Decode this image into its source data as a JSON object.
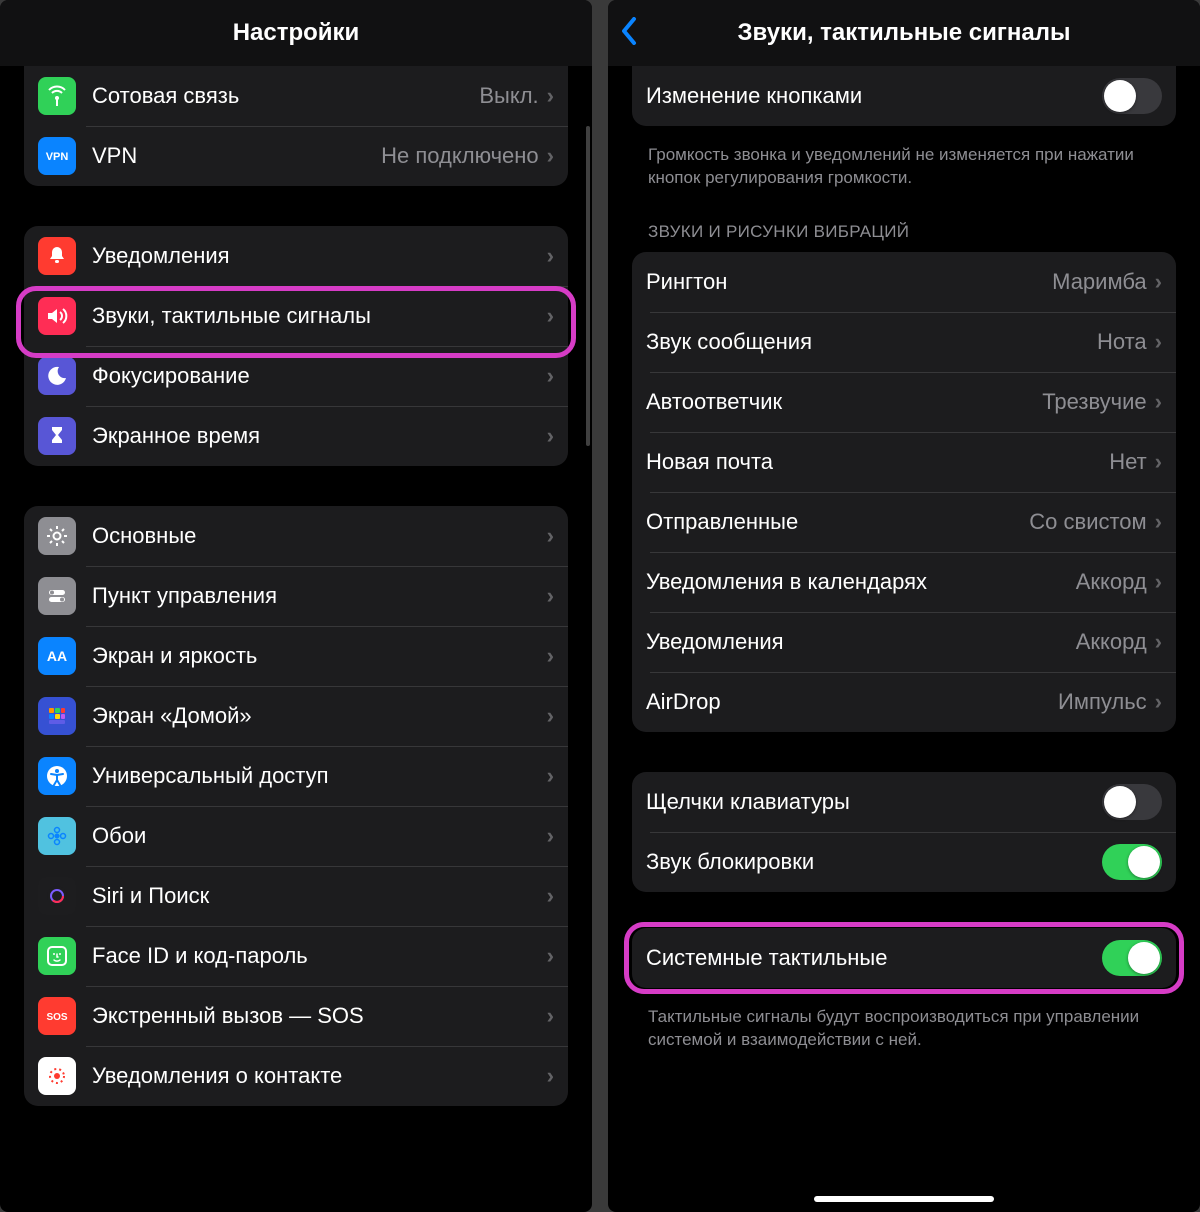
{
  "left": {
    "title": "Настройки",
    "group1": [
      {
        "icon": "antenna",
        "bg": "#30d158",
        "label": "Сотовая связь",
        "value": "Выкл."
      },
      {
        "icon": "vpn",
        "bg": "#0a84ff",
        "label": "VPN",
        "value": "Не подключено"
      }
    ],
    "group2": [
      {
        "icon": "bell",
        "bg": "#ff3b30",
        "label": "Уведомления"
      },
      {
        "icon": "speaker",
        "bg": "#ff2d55",
        "label": "Звуки, тактильные сигналы"
      },
      {
        "icon": "moon",
        "bg": "#5856d6",
        "label": "Фокусирование"
      },
      {
        "icon": "hourglass",
        "bg": "#5856d6",
        "label": "Экранное время"
      }
    ],
    "group3": [
      {
        "icon": "gear",
        "bg": "#8e8e93",
        "label": "Основные"
      },
      {
        "icon": "switches",
        "bg": "#8e8e93",
        "label": "Пункт управления"
      },
      {
        "icon": "aa",
        "bg": "#0a84ff",
        "label": "Экран и яркость"
      },
      {
        "icon": "grid",
        "bg": "#3651d3",
        "label": "Экран «Домой»"
      },
      {
        "icon": "accessibility",
        "bg": "#0a84ff",
        "label": "Универсальный доступ"
      },
      {
        "icon": "flower",
        "bg": "#50c2e0",
        "label": "Обои"
      },
      {
        "icon": "siri",
        "bg": "#1d1d1f",
        "label": "Siri и Поиск"
      },
      {
        "icon": "faceid",
        "bg": "#30d158",
        "label": "Face ID и код-пароль"
      },
      {
        "icon": "sos",
        "bg": "#ff3b30",
        "label": "Экстренный вызов — SOS"
      },
      {
        "icon": "exposure",
        "bg": "#ffffff",
        "label": "Уведомления о контакте"
      }
    ]
  },
  "right": {
    "title": "Звуки, тактильные сигналы",
    "topRow": {
      "label": "Изменение кнопками",
      "on": false
    },
    "topFooter": "Громкость звонка и уведомлений не изменяется при нажатии кнопок регулирования громкости.",
    "soundsHeader": "ЗВУКИ И РИСУНКИ ВИБРАЦИЙ",
    "sounds": [
      {
        "label": "Рингтон",
        "value": "Маримба"
      },
      {
        "label": "Звук сообщения",
        "value": "Нота"
      },
      {
        "label": "Автоответчик",
        "value": "Трезвучие"
      },
      {
        "label": "Новая почта",
        "value": "Нет"
      },
      {
        "label": "Отправленные",
        "value": "Со свистом"
      },
      {
        "label": "Уведомления в календарях",
        "value": "Аккорд"
      },
      {
        "label": "Уведомления",
        "value": "Аккорд"
      },
      {
        "label": "AirDrop",
        "value": "Импульс"
      }
    ],
    "toggles2": [
      {
        "label": "Щелчки клавиатуры",
        "on": false
      },
      {
        "label": "Звук блокировки",
        "on": true
      }
    ],
    "haptic": {
      "label": "Системные тактильные",
      "on": true
    },
    "hapticFooter": "Тактильные сигналы будут воспроизводиться при управлении системой и взаимодействии с ней."
  }
}
